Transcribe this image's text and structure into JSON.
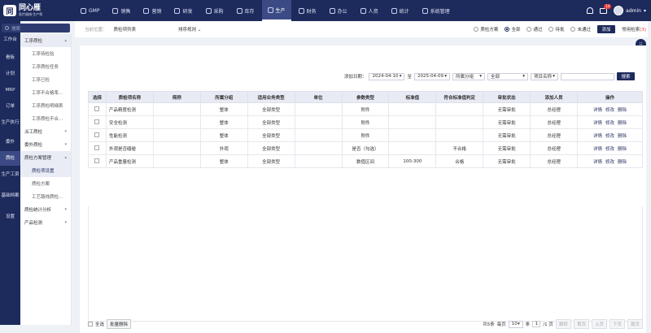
{
  "app": {
    "logo_mark": "同",
    "name": "同心雁",
    "sub": "医疗器械·生产帮"
  },
  "topnav": [
    {
      "label": "GMP",
      "active": false
    },
    {
      "label": "销售",
      "active": false
    },
    {
      "label": "营销",
      "active": false
    },
    {
      "label": "研发",
      "active": false
    },
    {
      "label": "采购",
      "active": false
    },
    {
      "label": "库存",
      "active": false
    },
    {
      "label": "生产",
      "active": true
    },
    {
      "label": "财务",
      "active": false
    },
    {
      "label": "办公",
      "active": false
    },
    {
      "label": "人资",
      "active": false
    },
    {
      "label": "统计",
      "active": false
    },
    {
      "label": "系统管理",
      "active": false
    }
  ],
  "user": {
    "name": "admin",
    "badge": "14",
    "caret": "▾"
  },
  "rail": [
    "工作台",
    "看板",
    "计划",
    "MRP",
    "订单",
    "生产执行",
    "委外",
    "质检",
    "生产工资",
    "基础档案",
    "设置"
  ],
  "search": {
    "placeholder": "搜索"
  },
  "side": {
    "group1": "工序质检",
    "group1_items": [
      "工序待检验",
      "工序质检任务",
      "工序已检",
      "工序不合格率...",
      "工序质检明细表",
      "工序质检不合..."
    ],
    "group2": "派工质检",
    "group3": "委外质检",
    "group4": "质检方案管理",
    "group4_items": [
      "质检项设置",
      "质检方案",
      "工艺路线质检..."
    ],
    "group5": "质检统计分析",
    "group6": "产品检测"
  },
  "crumb": {
    "prefix": "当前位置：",
    "current": "质检项列表",
    "sort": "排序规则"
  },
  "radios": [
    {
      "label": "质检方案",
      "on": false
    },
    {
      "label": "全部",
      "on": true
    },
    {
      "label": "通过",
      "on": false
    },
    {
      "label": "待批",
      "on": false
    },
    {
      "label": "未通过",
      "on": false
    }
  ],
  "actions": {
    "add": "添加",
    "common": "常用检索",
    "common_count": "(3)"
  },
  "filters": {
    "date_label": "添加日期：",
    "date_from": "2024-04-10",
    "to": "至",
    "date_to": "2025-04-09",
    "group": "所属分组",
    "scope": "全部",
    "item_name": "项目名称",
    "keyword": "",
    "search": "搜索"
  },
  "table": {
    "headers": [
      "选择",
      "质检项名称",
      "简称",
      "所属分组",
      "适用业务类型",
      "单位",
      "参数类型",
      "标准值",
      "符合标准值判定",
      "审批状态",
      "添加人员",
      "操作"
    ],
    "rows": [
      [
        "",
        "产品精度检测",
        "",
        "整体",
        "全部类型",
        "",
        "附件",
        "",
        "",
        "无需审批",
        "总经理",
        ""
      ],
      [
        "",
        "安全检测",
        "",
        "整体",
        "全部类型",
        "",
        "附件",
        "",
        "",
        "无需审批",
        "总经理",
        ""
      ],
      [
        "",
        "性能检测",
        "",
        "整体",
        "全部类型",
        "",
        "附件",
        "",
        "",
        "无需审批",
        "总经理",
        ""
      ],
      [
        "",
        "外观是否磕碰",
        "",
        "外观",
        "全部类型",
        "",
        "是否（勾选）",
        "",
        "不合格",
        "无需审批",
        "总经理",
        ""
      ],
      [
        "",
        "产品重量检测",
        "",
        "整体",
        "全部类型",
        "",
        "数值区间",
        "100-300",
        "合格",
        "无需审批",
        "总经理",
        ""
      ]
    ],
    "ops": [
      "详情",
      "修改",
      "删除"
    ]
  },
  "footer": {
    "select_all": "全选",
    "bulk_delete": "批量删除",
    "total": "共5条",
    "per_page": "每页",
    "page_size": "10",
    "unit": "条",
    "page": "1",
    "of": "/1 页",
    "jump": "跳转",
    "first": "首页",
    "prev": "上页",
    "next": "下页",
    "last": "尾页"
  },
  "colors": {
    "nav_bg": "#1d2a5c",
    "accent": "#1d2a5c",
    "badge": "#f23a3a"
  }
}
